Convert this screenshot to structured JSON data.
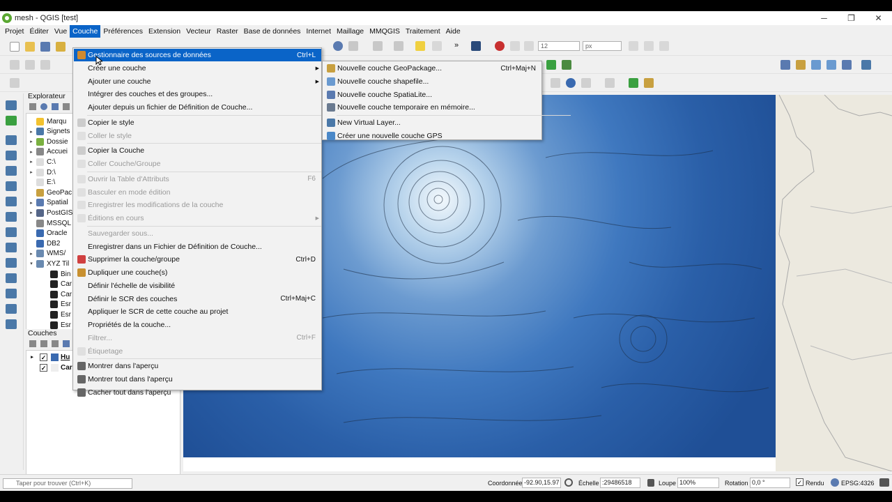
{
  "window": {
    "title": "mesh - QGIS [test]",
    "minimize": "─",
    "maximize": "❐",
    "close": "✕"
  },
  "menubar": [
    "Projet",
    "Éditer",
    "Vue",
    "Couche",
    "Préférences",
    "Extension",
    "Vecteur",
    "Raster",
    "Base de données",
    "Internet",
    "Maillage",
    "MMQGIS",
    "Traitement",
    "Aide"
  ],
  "toolbar": {
    "font_size": "12",
    "unit": "px"
  },
  "explorer": {
    "title": "Explorateur",
    "items": [
      {
        "label": "Marqu",
        "arrow": "",
        "color": "#f2c230"
      },
      {
        "label": "Signets",
        "arrow": "▸",
        "color": "#4a78a8"
      },
      {
        "label": "Dossie",
        "arrow": "▸",
        "color": "#7ab040"
      },
      {
        "label": "Accuei",
        "arrow": "▸",
        "color": "#888888"
      },
      {
        "label": "C:\\",
        "arrow": "▸",
        "color": "#dddddd"
      },
      {
        "label": "D:\\",
        "arrow": "▸",
        "color": "#dddddd"
      },
      {
        "label": "E:\\",
        "arrow": "",
        "color": "#dddddd"
      },
      {
        "label": "GeoPac",
        "arrow": "",
        "color": "#c8a040"
      },
      {
        "label": "Spatial",
        "arrow": "▸",
        "color": "#5a7ab0"
      },
      {
        "label": "PostGIS",
        "arrow": "▸",
        "color": "#556688"
      },
      {
        "label": "MSSQL",
        "arrow": "",
        "color": "#888888"
      },
      {
        "label": "Oracle",
        "arrow": "",
        "color": "#3a6ab0"
      },
      {
        "label": "DB2",
        "arrow": "",
        "color": "#3a6ab0"
      },
      {
        "label": "WMS/​",
        "arrow": "▸",
        "color": "#6a8ab0"
      },
      {
        "label": "XYZ Til",
        "arrow": "▾",
        "color": "#6a8ab0"
      },
      {
        "label": "Bin",
        "arrow": "",
        "color": "#222222",
        "indent": true
      },
      {
        "label": "Car",
        "arrow": "",
        "color": "#222222",
        "indent": true
      },
      {
        "label": "Car",
        "arrow": "",
        "color": "#222222",
        "indent": true
      },
      {
        "label": "Esr",
        "arrow": "",
        "color": "#222222",
        "indent": true
      },
      {
        "label": "Esr",
        "arrow": "",
        "color": "#222222",
        "indent": true
      },
      {
        "label": "Esr",
        "arrow": "",
        "color": "#222222",
        "indent": true
      }
    ]
  },
  "layers": {
    "title": "Couches",
    "items": [
      {
        "label": "Hu",
        "checked": "✓",
        "arrow": "▸"
      },
      {
        "label": "Car",
        "checked": "✓",
        "arrow": ""
      }
    ]
  },
  "couche_menu": [
    {
      "label": "Gestionnaire des sources de données",
      "shortcut": "Ctrl+L",
      "highlighted": true,
      "icon": "#d08a30"
    },
    {
      "label": "Créer une couche",
      "submenu": true
    },
    {
      "label": "Ajouter une couche",
      "submenu": true
    },
    {
      "label": "Intégrer des couches et des groupes..."
    },
    {
      "label": "Ajouter depuis un fichier de Définition de Couche..."
    },
    {
      "sep": true
    },
    {
      "label": "Copier le style",
      "icon": "#cccccc"
    },
    {
      "label": "Coller le style",
      "disabled": true,
      "icon": "#e0e0e0"
    },
    {
      "sep": true
    },
    {
      "label": "Copier la Couche",
      "icon": "#cccccc"
    },
    {
      "label": "Coller Couche/Groupe",
      "disabled": true,
      "icon": "#e0e0e0"
    },
    {
      "sep": true
    },
    {
      "label": "Ouvrir la Table d'Attributs",
      "shortcut": "F6",
      "disabled": true,
      "icon": "#e0e0e0"
    },
    {
      "label": "Basculer en mode édition",
      "disabled": true,
      "icon": "#e0e0e0"
    },
    {
      "label": "Enregistrer les modifications de la couche",
      "disabled": true,
      "icon": "#e0e0e0"
    },
    {
      "label": "Éditions en cours",
      "disabled": true,
      "submenu": true,
      "icon": "#e0e0e0"
    },
    {
      "sep": true
    },
    {
      "label": "Sauvegarder sous...",
      "disabled": true
    },
    {
      "label": "Enregistrer dans un Fichier de Définition de Couche..."
    },
    {
      "label": "Supprimer la couche/groupe",
      "shortcut": "Ctrl+D",
      "icon": "#d04040"
    },
    {
      "label": "Dupliquer une couche(s)",
      "icon": "#c89030"
    },
    {
      "label": "Définir l'échelle de visibilité"
    },
    {
      "label": "Définir le SCR des couches",
      "shortcut": "Ctrl+Maj+C"
    },
    {
      "label": "Appliquer le SCR de cette couche au projet"
    },
    {
      "label": "Propriétés de la couche..."
    },
    {
      "label": "Filtrer...",
      "shortcut": "Ctrl+F",
      "disabled": true
    },
    {
      "label": "Étiquetage",
      "disabled": true,
      "icon": "#e0e0e0"
    },
    {
      "sep": true
    },
    {
      "label": "Montrer dans l'aperçu",
      "icon": "#666666"
    },
    {
      "label": "Montrer tout dans l'aperçu",
      "icon": "#666666"
    },
    {
      "label": "Cacher tout dans l'aperçu",
      "icon": "#666666"
    }
  ],
  "create_submenu": [
    {
      "label": "Nouvelle couche GeoPackage...",
      "shortcut": "Ctrl+Maj+N",
      "icon": "#c8a040"
    },
    {
      "label": "Nouvelle couche shapefile...",
      "icon": "#6a9ad0"
    },
    {
      "label": "Nouvelle couche SpatiaLite...",
      "icon": "#5a7ab0"
    },
    {
      "label": "Nouvelle couche temporaire en mémoire...",
      "icon": "#6a7a90"
    },
    {
      "sep": true
    },
    {
      "label": "New Virtual Layer...",
      "icon": "#4a78a8"
    },
    {
      "label": "Créer une nouvelle couche GPS",
      "icon": "#4a88c8"
    }
  ],
  "statusbar": {
    "search_placeholder": "Taper pour trouver (Ctrl+K)",
    "coord_label": "Coordonnée",
    "coord_value": "-92.90,15.97",
    "scale_label": "Échelle",
    "scale_value": ":29486518",
    "zoom_label": "Loupe",
    "zoom_value": "100%",
    "rotation_label": "Rotation",
    "rotation_value": "0,0 °",
    "render_label": "Rendu",
    "render_checked": "✓",
    "crs": "EPSG:4326"
  }
}
